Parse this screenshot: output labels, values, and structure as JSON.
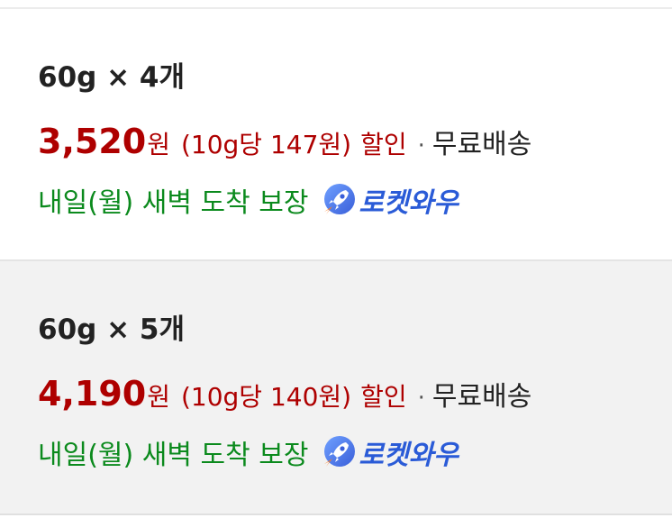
{
  "options": [
    {
      "title": "60g × 4개",
      "price": "3,520",
      "price_unit": "원",
      "unit_price": "(10g당 147원)",
      "discount_label": "할인",
      "separator": "·",
      "shipping": "무료배송",
      "delivery": "내일(월) 새벽 도착 보장",
      "badge": "로켓와우"
    },
    {
      "title": "60g × 5개",
      "price": "4,190",
      "price_unit": "원",
      "unit_price": "(10g당 140원)",
      "discount_label": "할인",
      "separator": "·",
      "shipping": "무료배송",
      "delivery": "내일(월) 새벽 도착 보장",
      "badge": "로켓와우"
    }
  ],
  "colors": {
    "price": "#ae0000",
    "delivery": "#0b8a1d",
    "badge": "#2a5bd7",
    "selected_background": "#f2f2f2"
  },
  "icons": {
    "badge_icon": "rocket-icon"
  }
}
